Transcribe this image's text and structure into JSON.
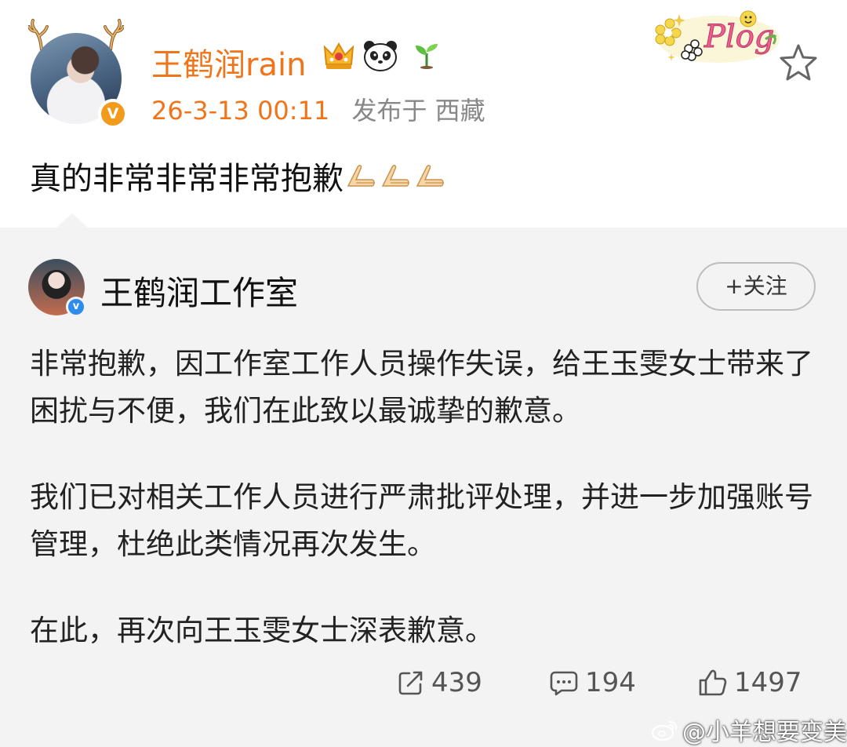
{
  "post": {
    "username": "王鹤润rain",
    "time": "26-3-13 00:11",
    "location": "发布于 西藏",
    "text": "真的非常非常非常抱歉",
    "verified_badge": "V",
    "icons": [
      "antler-icon",
      "crown-icon",
      "panda-icon",
      "sprout-icon",
      "plog-decoration",
      "star-icon",
      "pray-icon"
    ]
  },
  "repost": {
    "author": "王鹤润工作室",
    "follow_label": "+关注",
    "paragraphs": [
      "非常抱歉，因工作室工作人员操作失误，给王玉雯女士带来了困扰与不便，我们在此致以最诚挚的歉意。",
      "我们已对相关工作人员进行严肃批评处理，并进一步加强账号管理，杜绝此类情况再次发生。",
      "在此，再次向王玉雯女士深表歉意。"
    ],
    "stats": {
      "reposts": "439",
      "comments": "194",
      "likes": "1497"
    }
  },
  "watermark": "@小羊想要变美",
  "colors": {
    "username": "#f0741a",
    "verified_orange": "#f29a1b",
    "verified_blue": "#2d8cf0",
    "repost_bg": "#f3f3f3"
  }
}
